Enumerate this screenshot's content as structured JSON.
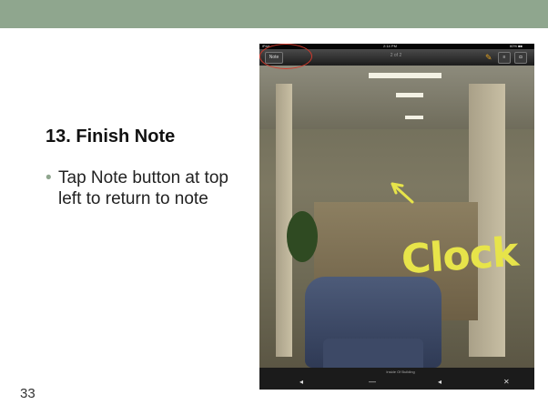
{
  "slide": {
    "title": "13. Finish Note",
    "bullet": "Tap Note button at top left to return to note",
    "number": "33"
  },
  "screenshot": {
    "status_left": "iPad",
    "status_time": "2:14 PM",
    "status_battery": "60% ■■",
    "nav_back_label": "Note",
    "nav_title": "2 of 2",
    "bottom_caption": "Inside Of Building",
    "annotation_text": "Clock",
    "close_symbol": "✕"
  },
  "colors": {
    "accent_green": "#8fa68e",
    "annotation_red": "#d23a2c",
    "handwriting_yellow": "#e7e44a"
  },
  "icons": {
    "pencil": "pencil-icon",
    "list": "list-icon",
    "camera": "camera-icon",
    "close": "close-icon",
    "prev": "prev-icon",
    "next": "next-icon"
  }
}
